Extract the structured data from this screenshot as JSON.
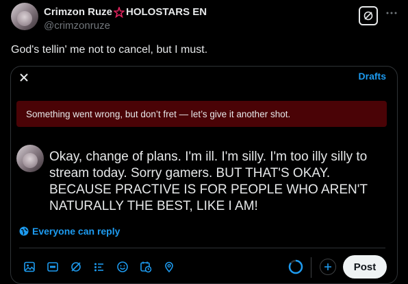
{
  "author": {
    "display_name": "Crimzon Ruze",
    "org_tag": "HOLOSTARS EN",
    "handle": "@crimzonruze",
    "badge_icon": "red-star-icon"
  },
  "tweet": {
    "text": "God's tellin' me not to cancel, but I must."
  },
  "compose": {
    "drafts_label": "Drafts",
    "error_message": "Something went wrong, but don’t fret — let’s give it another shot.",
    "text": "Okay, change of plans.  I'm ill.  I'm silly.  I'm too illy silly to stream today.  Sorry gamers.  BUT THAT'S OKAY.  BECAUSE PRACTIVE IS FOR PEOPLE WHO AREN'T NATURALLY THE BEST, LIKE I AM!",
    "reply_setting": "Everyone can reply",
    "post_label": "Post",
    "toolbar_icons": [
      "image-icon",
      "gif-icon",
      "grok-icon",
      "poll-icon",
      "emoji-icon",
      "schedule-icon",
      "location-icon"
    ]
  },
  "colors": {
    "background": "#000000",
    "accent": "#1d9bf0",
    "error_bg": "#4a0306",
    "text": "#e7e9ea",
    "muted": "#71767b"
  }
}
